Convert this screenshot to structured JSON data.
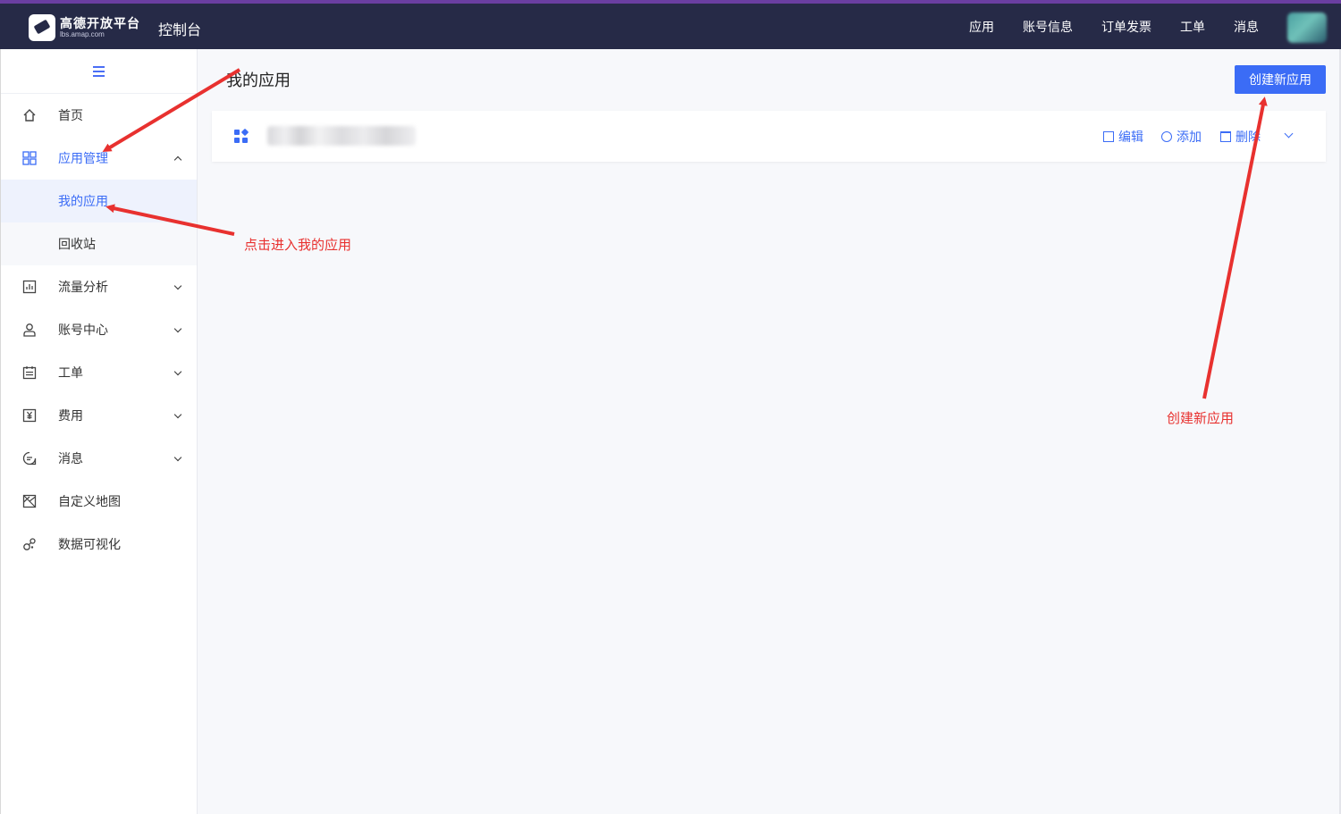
{
  "topbar": {
    "logo_name": "高德开放平台",
    "logo_sub": "lbs.amap.com",
    "console_title": "控制台",
    "nav": [
      "应用",
      "账号信息",
      "订单发票",
      "工单",
      "消息"
    ]
  },
  "sidebar": {
    "items": [
      {
        "label": "首页",
        "icon": "home-icon"
      },
      {
        "label": "应用管理",
        "icon": "grid-icon",
        "expanded": true,
        "active": true,
        "children": [
          {
            "label": "我的应用",
            "selected": true
          },
          {
            "label": "回收站"
          }
        ]
      },
      {
        "label": "流量分析",
        "icon": "chart-icon"
      },
      {
        "label": "账号中心",
        "icon": "user-icon"
      },
      {
        "label": "工单",
        "icon": "ticket-icon"
      },
      {
        "label": "费用",
        "icon": "yen-icon"
      },
      {
        "label": "消息",
        "icon": "message-icon"
      },
      {
        "label": "自定义地图",
        "icon": "map-icon"
      },
      {
        "label": "数据可视化",
        "icon": "visualization-icon"
      }
    ]
  },
  "main": {
    "page_title": "我的应用",
    "create_button": "创建新应用",
    "app_card": {
      "actions": {
        "edit": "编辑",
        "add": "添加",
        "delete": "删除"
      }
    }
  },
  "annotations": {
    "enter_my_apps": "点击进入我的应用",
    "create_new_app": "创建新应用"
  },
  "colors": {
    "topbar": "#262a47",
    "accent": "#3b6cf6",
    "annotation": "#e8312f",
    "top_stripe": "#6a3ea1"
  }
}
